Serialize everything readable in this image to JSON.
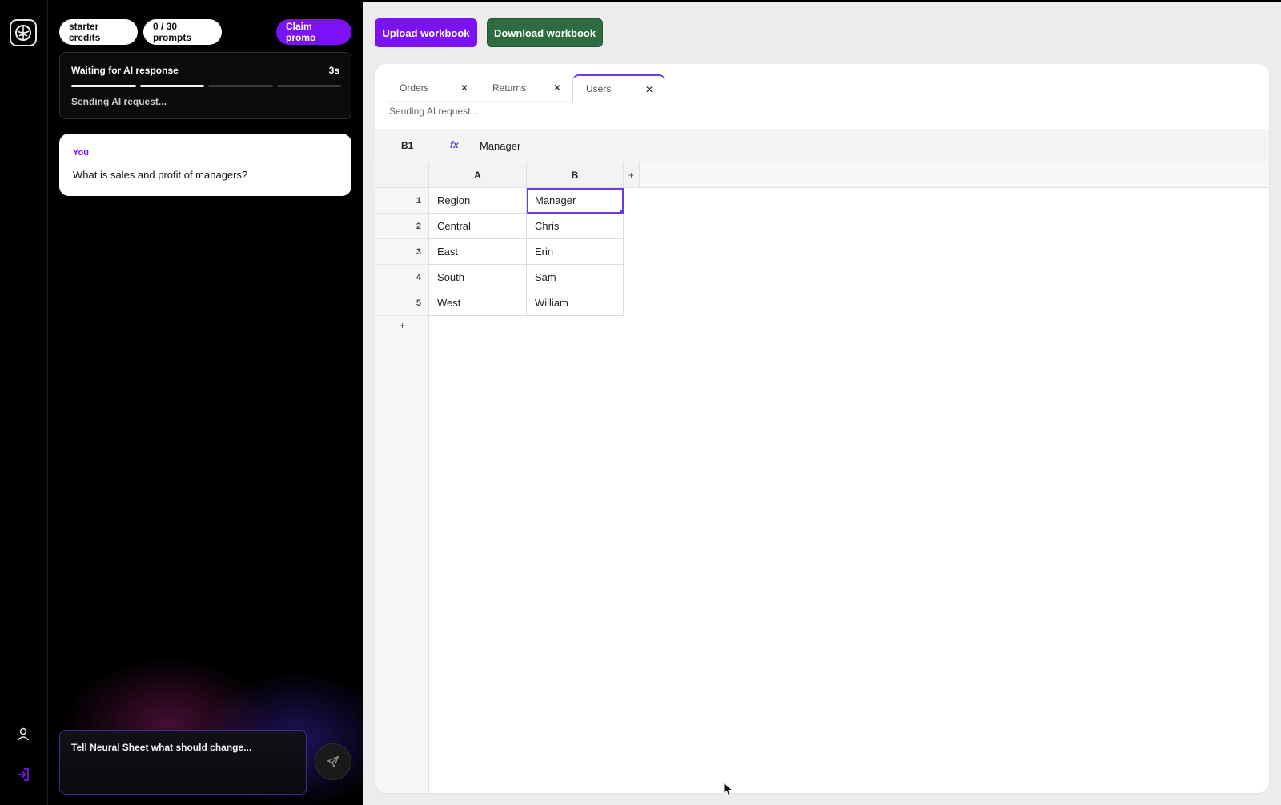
{
  "rail": {
    "logo_icon": "brain-logo-icon",
    "profile_icon": "user-icon",
    "signin_icon": "sign-in-icon",
    "accent": "#7a12f5"
  },
  "chat": {
    "credits_label": "starter credits",
    "prompts_label": "0 / 30 prompts",
    "promo_label": "Claim promo",
    "status": {
      "title": "Waiting for AI response",
      "elapsed": "3s",
      "subtitle": "Sending AI request...",
      "progress_steps_done": 2,
      "progress_steps_total": 4
    },
    "message": {
      "author": "You",
      "text": "What is sales and profit of managers?"
    },
    "composer_placeholder": "Tell Neural Sheet what should change...",
    "send_icon": "send-icon"
  },
  "workspace": {
    "upload_label": "Upload workbook",
    "download_label": "Download workbook",
    "upload_color": "#7a12f5",
    "download_color": "#2e6b40",
    "tabs": [
      {
        "label": "Orders",
        "close": "✕"
      },
      {
        "label": "Returns",
        "close": "✕"
      },
      {
        "label": "Users",
        "close": "✕"
      }
    ],
    "active_tab": "Users",
    "sheet_status": "Sending AI request...",
    "formula": {
      "cell_ref": "B1",
      "fx_label": "fx",
      "value": "Manager"
    },
    "columns": [
      "A",
      "B"
    ],
    "add_col_label": "+",
    "add_row_label": "+",
    "rows": [
      {
        "num": "1",
        "a": "Region",
        "b": "Manager"
      },
      {
        "num": "2",
        "a": "Central",
        "b": "Chris"
      },
      {
        "num": "3",
        "a": "East",
        "b": "Erin"
      },
      {
        "num": "4",
        "a": "South",
        "b": "Sam"
      },
      {
        "num": "5",
        "a": "West",
        "b": "William"
      }
    ],
    "selection_color": "#6a3de0"
  }
}
